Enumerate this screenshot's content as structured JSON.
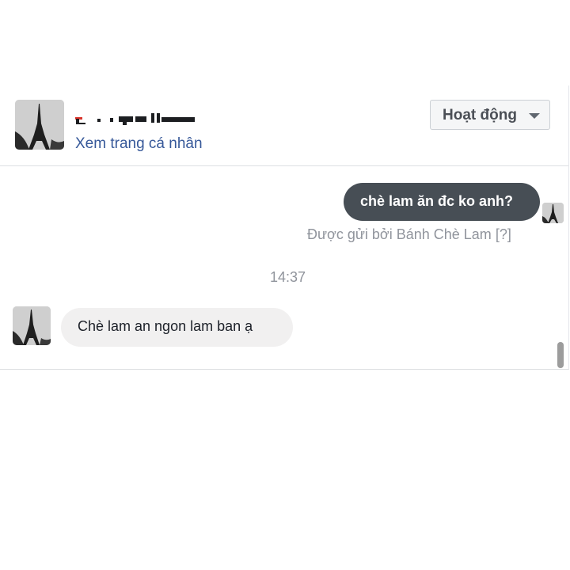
{
  "conversation_header": {
    "profile_link": "Xem trang cá nhân",
    "status_button": {
      "label": "Hoạt động",
      "icon": "chevron-down-icon"
    }
  },
  "messages": [
    {
      "direction": "outgoing",
      "text": "chè lam ăn đc ko anh?"
    },
    {
      "direction": "incoming",
      "text": "Chè lam an ngon lam ban ạ"
    }
  ],
  "sent_by": {
    "text": "Được gửi bởi Bánh Chè Lam",
    "help": "[?]"
  },
  "timestamp": "14:37",
  "colors": {
    "outgoing_bubble": "#474e55",
    "incoming_bubble": "#f1f0f0",
    "link": "#365899",
    "meta_text": "#90949c"
  }
}
